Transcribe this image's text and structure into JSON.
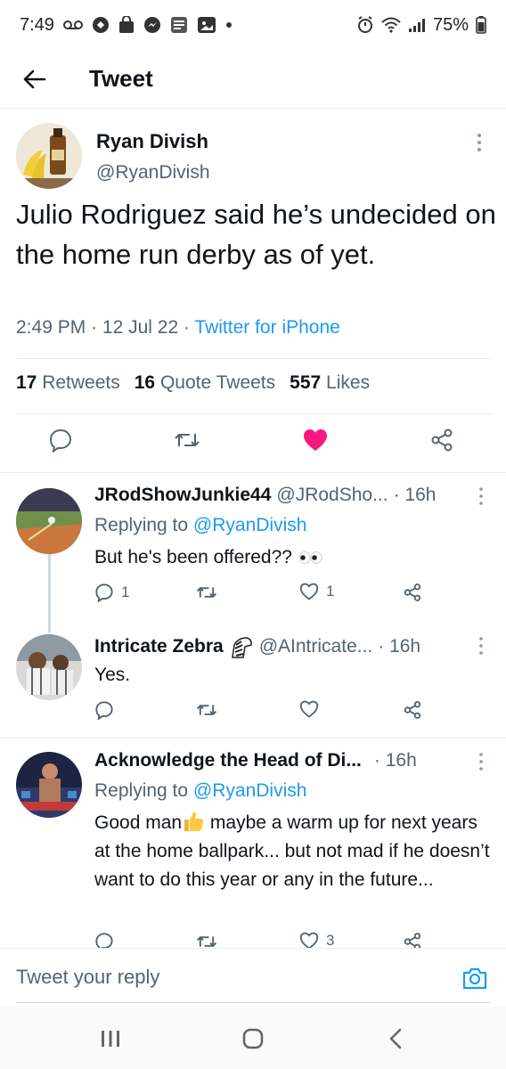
{
  "status_bar": {
    "time": "7:49",
    "battery": "75%"
  },
  "header": {
    "title": "Tweet"
  },
  "main_tweet": {
    "author_name": "Ryan Divish",
    "author_handle": "@RyanDivish",
    "text": "Julio Rodriguez said he’s undecided on the home run derby as of yet.",
    "time": "2:49 PM",
    "date": "12 Jul 22",
    "source": "Twitter for iPhone",
    "retweets_count": "17",
    "retweets_label": "Retweets",
    "quote_count": "16",
    "quote_label": "Quote Tweets",
    "likes_count": "557",
    "likes_label": "Likes",
    "liked": true
  },
  "replies": [
    {
      "name": "JRodShowJunkie44",
      "handle": "@JRodSho...",
      "time": "· 16h",
      "replying_prefix": "Replying to",
      "replying_to": "@RyanDivish",
      "text": "But he's been offered??",
      "reply_count": "1",
      "retweet_count": "",
      "like_count": "1"
    },
    {
      "name": "Intricate Zebra",
      "handle": "@AIntricate...",
      "time": "· 16h",
      "text": "Yes.",
      "reply_count": "",
      "retweet_count": "",
      "like_count": ""
    },
    {
      "name": "Acknowledge the Head of Di...",
      "time": "· 16h",
      "replying_prefix": "Replying to",
      "replying_to": "@RyanDivish",
      "text_line1": "Good man",
      "text_rest": " maybe a warm up for next years at the home ballpark... but not mad if he doesn’t want to do this year or any in the future...",
      "like_count": "3"
    }
  ],
  "reply_bar": {
    "placeholder": "Tweet your reply"
  },
  "colors": {
    "accent": "#1d9bf0",
    "like": "#f91880",
    "secondary_text": "#536471"
  }
}
